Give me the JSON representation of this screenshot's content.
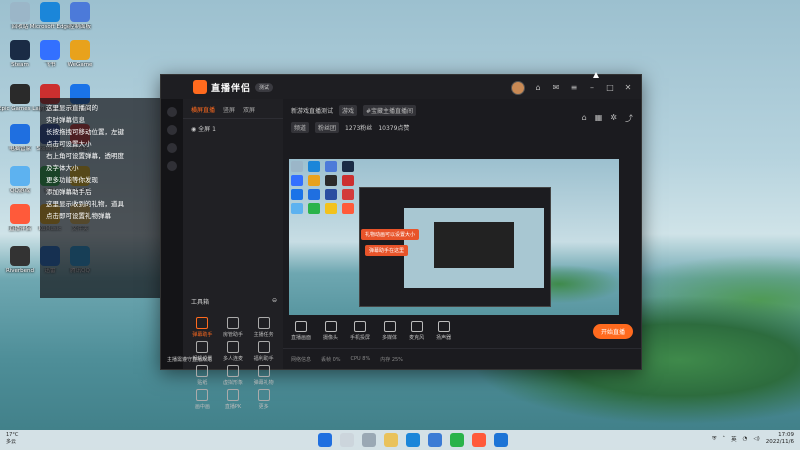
{
  "desktop": {
    "icons": [
      {
        "label": "回收站",
        "color": "#9bb6c8"
      },
      {
        "label": "Microsoft Edge",
        "color": "#1b86d9"
      },
      {
        "label": "控制面板",
        "color": "#4c7ad9"
      },
      {
        "label": "Steam",
        "color": "#1a2b45"
      },
      {
        "label": "飞书",
        "color": "#3370ff"
      },
      {
        "label": "WeGame",
        "color": "#e8a21c"
      },
      {
        "label": "Epic Games Launcher",
        "color": "#2a2a2a"
      },
      {
        "label": "腾讯游戏",
        "color": "#cc2f2f"
      },
      {
        "label": "腾讯会议",
        "color": "#1a73e8"
      },
      {
        "label": "电脑管家",
        "color": "#1f6fe0"
      },
      {
        "label": "Steam++",
        "color": "#2a4ea0"
      },
      {
        "label": "网易云",
        "color": "#d33b3b"
      },
      {
        "label": "QQ游戏",
        "color": "#5db2f0"
      },
      {
        "label": "微信",
        "color": "#2ab34a"
      },
      {
        "label": "QQ音乐",
        "color": "#f2c21d"
      },
      {
        "label": "直播伴侣",
        "color": "#ff5a3a"
      },
      {
        "label": "KuMusic",
        "color": "#f0b41c"
      },
      {
        "label": "文件夹",
        "color": "#e9c25b"
      },
      {
        "label": "Riverbend",
        "color": "#333333"
      },
      {
        "label": "迅雷",
        "color": "#1c74d6"
      },
      {
        "label": "腾讯QQ",
        "color": "#1ea0e8"
      }
    ]
  },
  "overlay_lines": [
    "这里显示直播间的",
    "实时弹幕信息",
    "长按拖拽可移动位置，左键",
    "点击可设置大小",
    "右上角可设置弹幕，透明度",
    "及字体大小",
    "更多功能等你发现",
    "添加弹幕助手后",
    "这里显示收到的礼物，道具",
    "点击即可设置礼物弹幕"
  ],
  "app": {
    "name": "直播伴侣",
    "badge": "测试",
    "left_tabs": [
      "横屏直播",
      "竖屏",
      "双屏"
    ],
    "scene_label": "全屏 1",
    "tools_title": "工具箱",
    "tools": [
      {
        "label": "弹幕助手",
        "active": true
      },
      {
        "label": "房管助手",
        "active": false
      },
      {
        "label": "主播任务",
        "active": false
      },
      {
        "label": "相机设置",
        "active": false
      },
      {
        "label": "多人连麦",
        "active": false
      },
      {
        "label": "福利助手",
        "active": false
      },
      {
        "label": "贴纸",
        "active": false
      },
      {
        "label": "虚拟形象",
        "active": false
      },
      {
        "label": "弹幕礼物",
        "active": false
      },
      {
        "label": "画中画",
        "active": false
      },
      {
        "label": "直播PK",
        "active": false
      },
      {
        "label": "更多",
        "active": false
      }
    ],
    "stage_title": "新游戏直播测试",
    "stage_tags": [
      "游戏",
      "#宝藏主播直播间"
    ],
    "stage_meta": [
      "频道",
      "粉丝团",
      "1273粉丝",
      "10379点赞"
    ],
    "toasts": [
      "礼物动画可以设置大小",
      "弹幕助手在这里"
    ],
    "controls": [
      "直播画面",
      "摄像头",
      "手机投屏",
      "多媒体",
      "麦克风",
      "扬声器"
    ],
    "live_button": "开始直播",
    "status": [
      "网络信息",
      "丢帧 0%",
      "CPU 8%",
      "内存 25%"
    ],
    "notice": "主播需遵守直播规范"
  },
  "taskbar": {
    "weather_temp": "17°C",
    "weather_desc": "多云",
    "ime": "英",
    "time": "17:09",
    "date": "2022/11/6"
  }
}
